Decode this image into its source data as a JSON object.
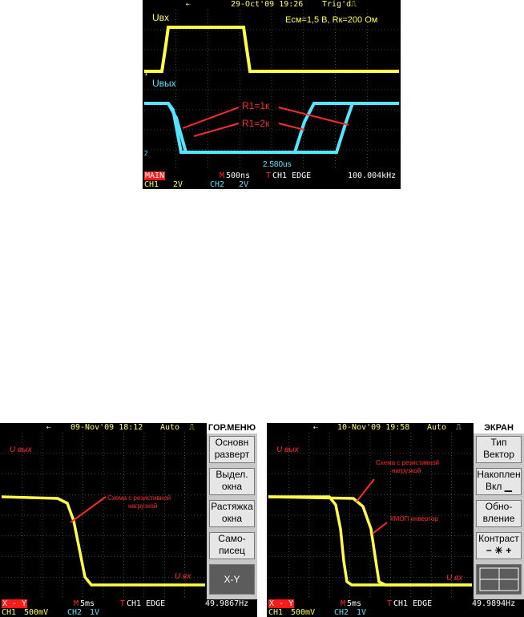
{
  "scope1": {
    "date": "29-Oct'09 19:26",
    "trig": "Trig'd",
    "label_in": "Uвх",
    "label_out": "Uвых",
    "params": "Eсм=1,5 В,   Rк=200 Ом",
    "ann_r1k": "R1=1к",
    "ann_r2k": "R1=2к",
    "cursor": "2.580us",
    "mode": "MAIN",
    "timebase": "500ns",
    "trigger": "CH1  EDGE",
    "freq": "100.004kHz",
    "ch1": "CH1",
    "ch1_scale": "2V",
    "ch2": "CH2",
    "ch2_scale": "2V",
    "m_marker": "M",
    "t_marker": "T",
    "gnd1": "1",
    "gnd2": "2"
  },
  "scope2": {
    "date": "09-Nov'09 18:12",
    "trig": "Auto",
    "label_y": "U вых",
    "label_x": "U вх",
    "annotation_line1": "Схема с резистивной",
    "annotation_line2": "нагрузкой",
    "mode": "X - Y",
    "timebase": "5ms",
    "trigger": "CH1  EDGE",
    "freq": "49.9867Hz",
    "ch1": "CH1",
    "ch1_scale": "500mV",
    "ch2": "CH2",
    "ch2_scale": "1V",
    "m_marker": "M",
    "t_marker": "T",
    "menu_title": "ГОР.МЕНЮ",
    "menu": [
      {
        "l1": "Основн",
        "l2": "разверт"
      },
      {
        "l1": "Выдел.",
        "l2": "окна"
      },
      {
        "l1": "Растяжка",
        "l2": "окна"
      },
      {
        "l1": "Само-",
        "l2": "писец"
      },
      {
        "l1": "X-Y",
        "l2": ""
      }
    ]
  },
  "scope3": {
    "date": "10-Nov'09 19:58",
    "trig": "Auto",
    "label_y": "U вых",
    "label_x": "U вх",
    "annotation_line1": "Схема с резистивной",
    "annotation_line2": "нагрузкой",
    "annotation_cmos": "КМОП инвертор",
    "mode": "X - Y",
    "timebase": "5ms",
    "trigger": "CH1  EDGE",
    "freq": "49.9894Hz",
    "ch1": "CH1",
    "ch1_scale": "500mV",
    "ch2": "CH2",
    "ch2_scale": "1V",
    "m_marker": "M",
    "t_marker": "T",
    "menu_title": "ЭКРАН",
    "menu": [
      {
        "l1": "Тип",
        "l2": "Вектор"
      },
      {
        "l1": "Накоплен",
        "l2": "Вкл"
      },
      {
        "l1": "Обно-",
        "l2": "вление"
      },
      {
        "l1": "Контраст",
        "l2": ""
      }
    ]
  },
  "colors": {
    "ch1": "#ffff44",
    "ch2": "#55e6ff",
    "annotation": "#ff2a2a",
    "background": "#000000"
  },
  "icons": [
    "usb-icon",
    "trigger-pulse-icon",
    "ground-marker-icon",
    "contrast-sun-icon",
    "grid-icon"
  ]
}
